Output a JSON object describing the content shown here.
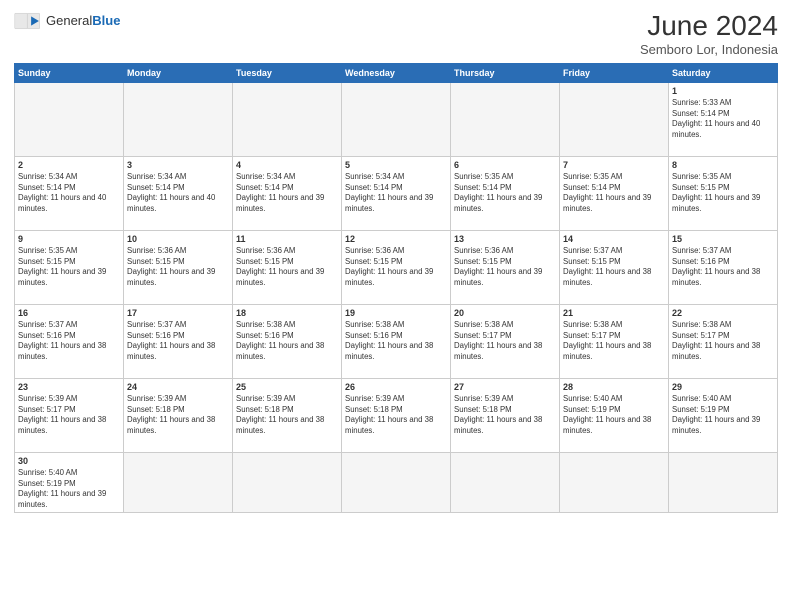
{
  "header": {
    "logo_line1": "General",
    "logo_line2": "Blue",
    "month_title": "June 2024",
    "subtitle": "Semboro Lor, Indonesia"
  },
  "weekdays": [
    "Sunday",
    "Monday",
    "Tuesday",
    "Wednesday",
    "Thursday",
    "Friday",
    "Saturday"
  ],
  "weeks": [
    [
      {
        "day": null,
        "info": null
      },
      {
        "day": null,
        "info": null
      },
      {
        "day": null,
        "info": null
      },
      {
        "day": null,
        "info": null
      },
      {
        "day": null,
        "info": null
      },
      {
        "day": null,
        "info": null
      },
      {
        "day": "1",
        "info": "Sunrise: 5:33 AM\nSunset: 5:14 PM\nDaylight: 11 hours and 40 minutes."
      }
    ],
    [
      {
        "day": "2",
        "info": "Sunrise: 5:34 AM\nSunset: 5:14 PM\nDaylight: 11 hours and 40 minutes."
      },
      {
        "day": "3",
        "info": "Sunrise: 5:34 AM\nSunset: 5:14 PM\nDaylight: 11 hours and 40 minutes."
      },
      {
        "day": "4",
        "info": "Sunrise: 5:34 AM\nSunset: 5:14 PM\nDaylight: 11 hours and 39 minutes."
      },
      {
        "day": "5",
        "info": "Sunrise: 5:34 AM\nSunset: 5:14 PM\nDaylight: 11 hours and 39 minutes."
      },
      {
        "day": "6",
        "info": "Sunrise: 5:35 AM\nSunset: 5:14 PM\nDaylight: 11 hours and 39 minutes."
      },
      {
        "day": "7",
        "info": "Sunrise: 5:35 AM\nSunset: 5:14 PM\nDaylight: 11 hours and 39 minutes."
      },
      {
        "day": "8",
        "info": "Sunrise: 5:35 AM\nSunset: 5:15 PM\nDaylight: 11 hours and 39 minutes."
      }
    ],
    [
      {
        "day": "9",
        "info": "Sunrise: 5:35 AM\nSunset: 5:15 PM\nDaylight: 11 hours and 39 minutes."
      },
      {
        "day": "10",
        "info": "Sunrise: 5:36 AM\nSunset: 5:15 PM\nDaylight: 11 hours and 39 minutes."
      },
      {
        "day": "11",
        "info": "Sunrise: 5:36 AM\nSunset: 5:15 PM\nDaylight: 11 hours and 39 minutes."
      },
      {
        "day": "12",
        "info": "Sunrise: 5:36 AM\nSunset: 5:15 PM\nDaylight: 11 hours and 39 minutes."
      },
      {
        "day": "13",
        "info": "Sunrise: 5:36 AM\nSunset: 5:15 PM\nDaylight: 11 hours and 39 minutes."
      },
      {
        "day": "14",
        "info": "Sunrise: 5:37 AM\nSunset: 5:15 PM\nDaylight: 11 hours and 38 minutes."
      },
      {
        "day": "15",
        "info": "Sunrise: 5:37 AM\nSunset: 5:16 PM\nDaylight: 11 hours and 38 minutes."
      }
    ],
    [
      {
        "day": "16",
        "info": "Sunrise: 5:37 AM\nSunset: 5:16 PM\nDaylight: 11 hours and 38 minutes."
      },
      {
        "day": "17",
        "info": "Sunrise: 5:37 AM\nSunset: 5:16 PM\nDaylight: 11 hours and 38 minutes."
      },
      {
        "day": "18",
        "info": "Sunrise: 5:38 AM\nSunset: 5:16 PM\nDaylight: 11 hours and 38 minutes."
      },
      {
        "day": "19",
        "info": "Sunrise: 5:38 AM\nSunset: 5:16 PM\nDaylight: 11 hours and 38 minutes."
      },
      {
        "day": "20",
        "info": "Sunrise: 5:38 AM\nSunset: 5:17 PM\nDaylight: 11 hours and 38 minutes."
      },
      {
        "day": "21",
        "info": "Sunrise: 5:38 AM\nSunset: 5:17 PM\nDaylight: 11 hours and 38 minutes."
      },
      {
        "day": "22",
        "info": "Sunrise: 5:38 AM\nSunset: 5:17 PM\nDaylight: 11 hours and 38 minutes."
      }
    ],
    [
      {
        "day": "23",
        "info": "Sunrise: 5:39 AM\nSunset: 5:17 PM\nDaylight: 11 hours and 38 minutes."
      },
      {
        "day": "24",
        "info": "Sunrise: 5:39 AM\nSunset: 5:18 PM\nDaylight: 11 hours and 38 minutes."
      },
      {
        "day": "25",
        "info": "Sunrise: 5:39 AM\nSunset: 5:18 PM\nDaylight: 11 hours and 38 minutes."
      },
      {
        "day": "26",
        "info": "Sunrise: 5:39 AM\nSunset: 5:18 PM\nDaylight: 11 hours and 38 minutes."
      },
      {
        "day": "27",
        "info": "Sunrise: 5:39 AM\nSunset: 5:18 PM\nDaylight: 11 hours and 38 minutes."
      },
      {
        "day": "28",
        "info": "Sunrise: 5:40 AM\nSunset: 5:19 PM\nDaylight: 11 hours and 38 minutes."
      },
      {
        "day": "29",
        "info": "Sunrise: 5:40 AM\nSunset: 5:19 PM\nDaylight: 11 hours and 39 minutes."
      }
    ],
    [
      {
        "day": "30",
        "info": "Sunrise: 5:40 AM\nSunset: 5:19 PM\nDaylight: 11 hours and 39 minutes."
      },
      {
        "day": null,
        "info": null
      },
      {
        "day": null,
        "info": null
      },
      {
        "day": null,
        "info": null
      },
      {
        "day": null,
        "info": null
      },
      {
        "day": null,
        "info": null
      },
      {
        "day": null,
        "info": null
      }
    ]
  ]
}
